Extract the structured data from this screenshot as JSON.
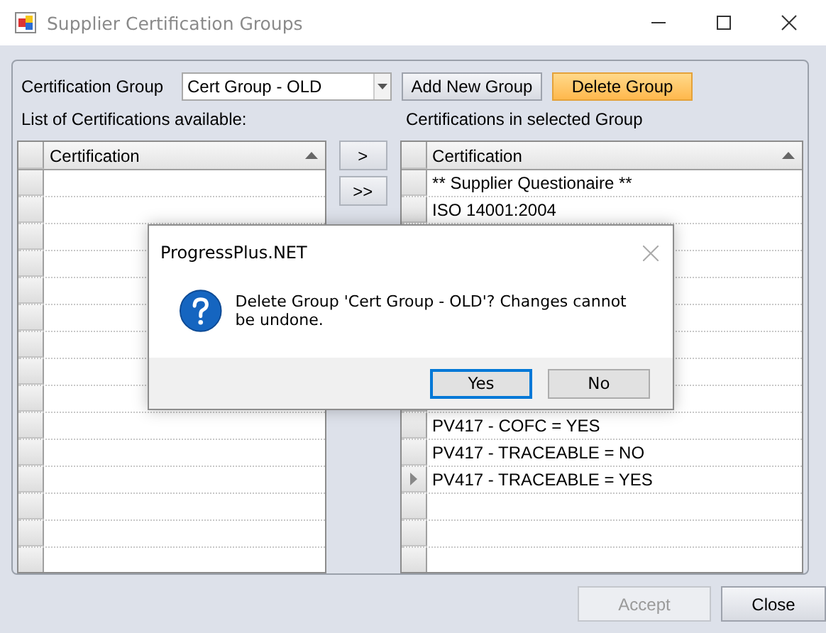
{
  "window": {
    "title": "Supplier Certification Groups"
  },
  "group_selector": {
    "label": "Certification Group",
    "value": "Cert Group - OLD"
  },
  "group_buttons": [
    {
      "label": "Add New Group",
      "highlighted": false
    },
    {
      "label": "Delete Group",
      "highlighted": true
    }
  ],
  "available_list": {
    "caption": "List of Certifications available:",
    "column": "Certification"
  },
  "move_buttons": [
    ">",
    ">>"
  ],
  "selected_list": {
    "caption": "Certifications in selected Group",
    "column": "Certification",
    "rows": [
      {
        "text": "** Supplier Questionaire **",
        "current": false
      },
      {
        "text": "ISO 14001:2004",
        "current": false
      },
      {
        "text": "PV417 - COFC = YES",
        "current": false
      },
      {
        "text": "PV417 - TRACEABLE = NO",
        "current": false
      },
      {
        "text": "PV417 - TRACEABLE = YES",
        "current": true
      }
    ]
  },
  "footer_buttons": [
    {
      "label": "Accept",
      "disabled": true
    },
    {
      "label": "Close",
      "disabled": false
    }
  ],
  "dialog": {
    "title": "ProgressPlus.NET",
    "message": "Delete Group 'Cert Group - OLD'? Changes cannot be undone.",
    "buttons": [
      {
        "label": "Yes",
        "default": true
      },
      {
        "label": "No",
        "default": false
      }
    ]
  }
}
